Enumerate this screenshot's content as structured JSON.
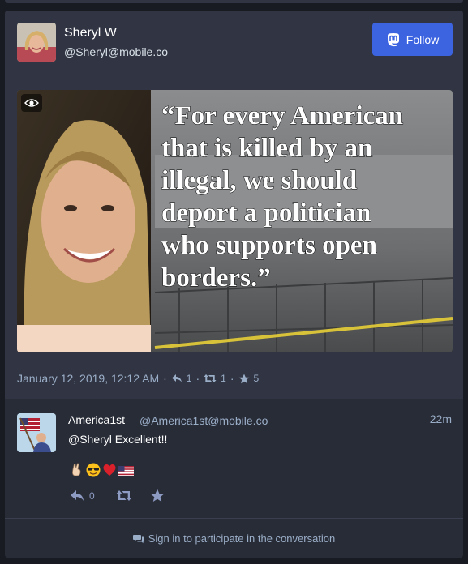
{
  "status": {
    "display_name": "Sheryl W",
    "account": "@Sheryl@mobile.co",
    "follow_label": "Follow",
    "media": {
      "quote": "“For every American that is killed by an illegal, we should deport a politician who supports open borders.”",
      "quote_lines": [
        "“For every American",
        "that is killed by an",
        "illegal, we should",
        "deport a politician",
        "who supports open",
        "borders.”"
      ],
      "icon": "eye-icon"
    },
    "timestamp": "January 12, 2019, 12:12 AM",
    "separator": "·",
    "replies": "1",
    "boosts": "1",
    "favourites": "5"
  },
  "reply": {
    "display_name": "America1st",
    "account": "@America1st@mobile.co",
    "time": "22m",
    "text": "@Sheryl Excellent!!",
    "emoji": [
      "victory-hand",
      "smiling-face-sunglasses",
      "red-heart",
      "us-flag"
    ],
    "replies": "0"
  },
  "footer": {
    "label": "Sign in to participate in the conversation",
    "icon": "comments-icon"
  },
  "colors": {
    "background": "#191b22",
    "panel": "#313543",
    "reply_bg": "#282c37",
    "accent": "#3c63e0",
    "muted_text": "#9baec8"
  }
}
